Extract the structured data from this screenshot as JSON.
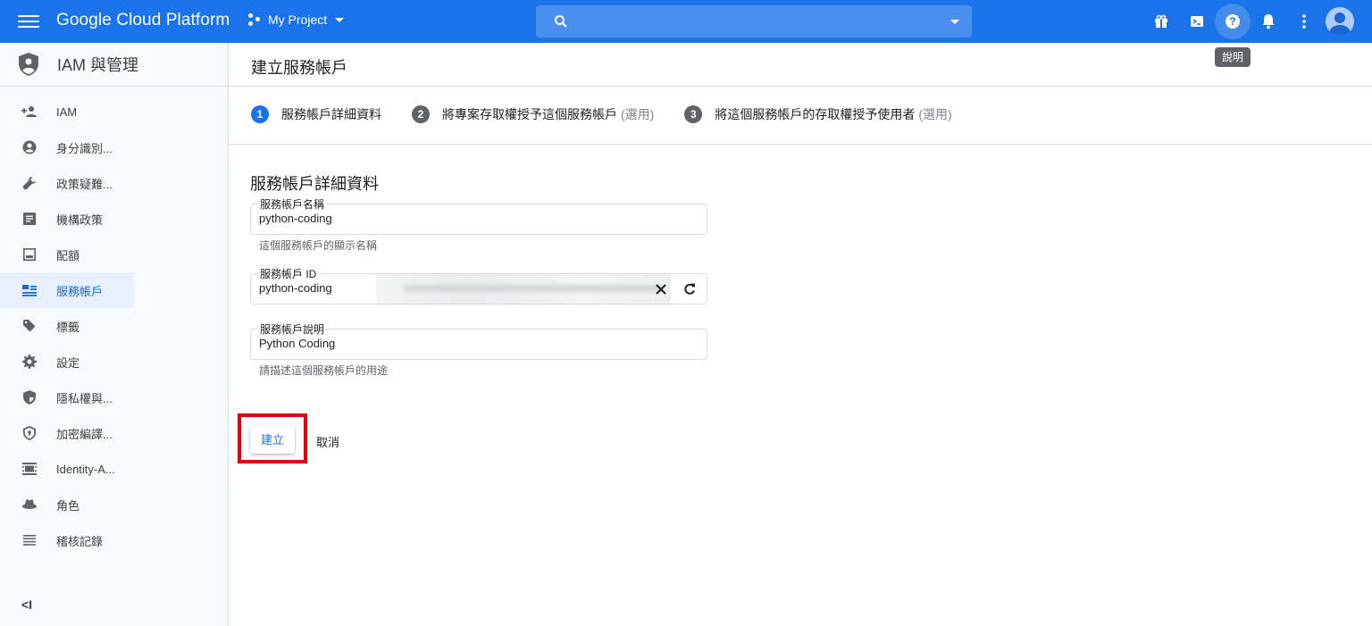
{
  "topbar": {
    "brand": "Google Cloud Platform",
    "project": "My Project",
    "search_placeholder": "",
    "tooltip": "說明",
    "icons": [
      "menu-icon",
      "gift-icon",
      "cloud-shell-icon",
      "help-icon",
      "notifications-icon",
      "more-vert-icon",
      "account-avatar"
    ]
  },
  "sidebar": {
    "title": "IAM 與管理",
    "items": [
      {
        "label": "IAM",
        "icon": "person-add-icon"
      },
      {
        "label": "身分識別...",
        "icon": "account-circle-icon"
      },
      {
        "label": "政策疑難...",
        "icon": "wrench-icon"
      },
      {
        "label": "機構政策",
        "icon": "list-alt-icon"
      },
      {
        "label": "配額",
        "icon": "quota-icon"
      },
      {
        "label": "服務帳戶",
        "icon": "service-account-icon",
        "active": true
      },
      {
        "label": "標籤",
        "icon": "tag-icon"
      },
      {
        "label": "設定",
        "icon": "settings-icon"
      },
      {
        "label": "隱私權與...",
        "icon": "privacy-shield-icon"
      },
      {
        "label": "加密編譯...",
        "icon": "encryption-shield-icon"
      },
      {
        "label": "Identity-A...",
        "icon": "identity-aware-icon"
      },
      {
        "label": "角色",
        "icon": "role-hat-icon"
      },
      {
        "label": "稽核記錄",
        "icon": "audit-log-icon"
      }
    ],
    "collapse_label": "<I"
  },
  "main": {
    "page_title": "建立服務帳戶",
    "steps": [
      {
        "num": "1",
        "label": "服務帳戶詳細資料",
        "optional": ""
      },
      {
        "num": "2",
        "label": "將專案存取權授予這個服務帳戶",
        "optional": "(選用)"
      },
      {
        "num": "3",
        "label": "將這個服務帳戶的存取權授予使用者",
        "optional": "(選用)"
      }
    ],
    "section_title": "服務帳戶詳細資料",
    "fields": {
      "name": {
        "label": "服務帳戶名稱",
        "value": "python-coding",
        "hint": "這個服務帳戶的顯示名稱"
      },
      "id": {
        "label": "服務帳戶 ID",
        "value": "python-coding"
      },
      "description": {
        "label": "服務帳戶說明",
        "value": "Python Coding",
        "hint": "請描述這個服務帳戶的用途"
      }
    },
    "create_label": "建立",
    "cancel_label": "取消"
  },
  "colors": {
    "topbar": "#1a73e8",
    "active_nav": "#e8f0fe",
    "highlight_box": "#e1000f"
  }
}
